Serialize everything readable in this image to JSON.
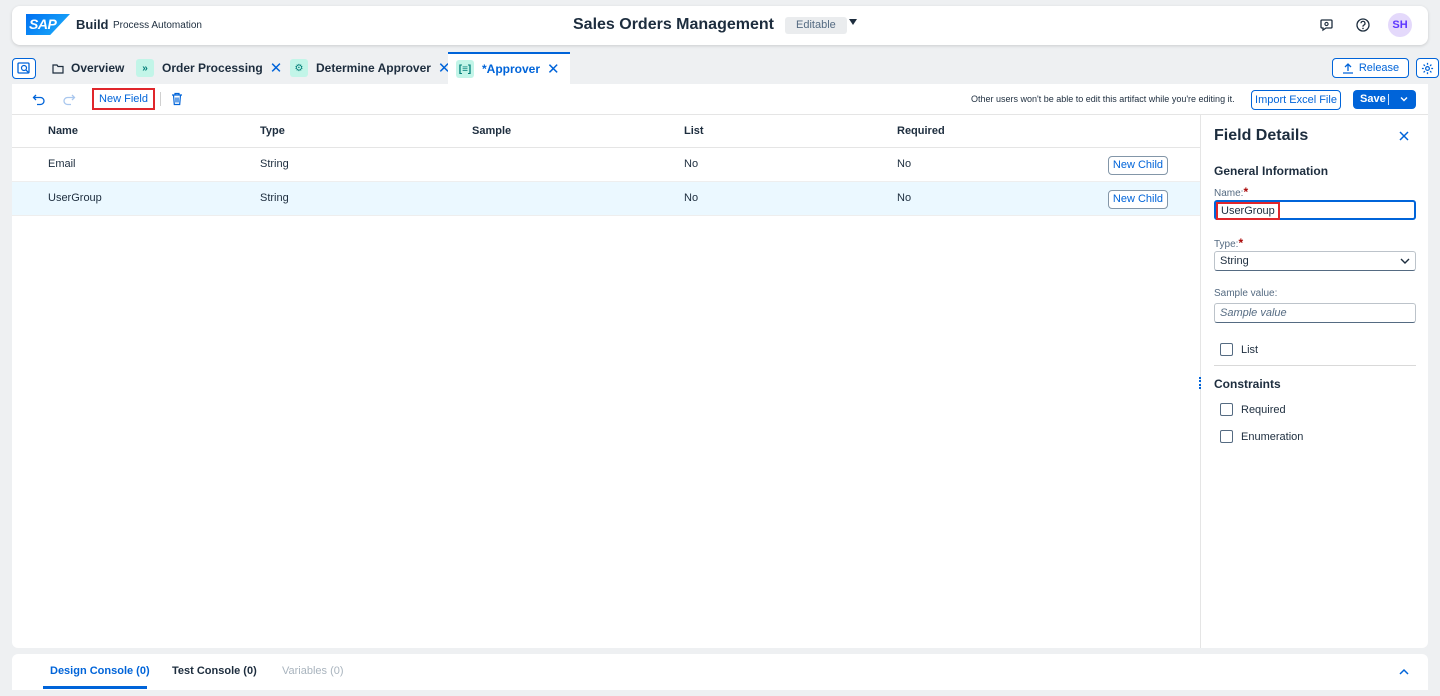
{
  "shell": {
    "logo_text": "SAP",
    "brand": "Build",
    "brand_sub": "Process Automation",
    "title": "Sales Orders Management",
    "status": "Editable",
    "avatar": "SH"
  },
  "tabs": [
    {
      "label": "Overview",
      "closable": false
    },
    {
      "label": "Order Processing",
      "closable": true
    },
    {
      "label": "Determine Approver",
      "closable": true
    },
    {
      "label": "*Approver",
      "closable": true,
      "active": true
    }
  ],
  "tab_actions": {
    "release": "Release"
  },
  "toolbar": {
    "new_field": "New Field",
    "note": "Other users won't be able to edit this artifact while you're editing it.",
    "import": "Import Excel File",
    "save": "Save"
  },
  "table": {
    "columns": [
      "Name",
      "Type",
      "Sample",
      "List",
      "Required"
    ],
    "rows": [
      {
        "name": "Email",
        "type": "String",
        "sample": "",
        "list": "No",
        "required": "No",
        "action": "New Child"
      },
      {
        "name": "UserGroup",
        "type": "String",
        "sample": "",
        "list": "No",
        "required": "No",
        "action": "New Child",
        "selected": true
      }
    ]
  },
  "details": {
    "title": "Field Details",
    "general": "General Information",
    "name_label": "Name:",
    "name_value": "UserGroup",
    "type_label": "Type:",
    "type_value": "String",
    "sample_label": "Sample value:",
    "sample_placeholder": "Sample value",
    "list_label": "List",
    "constraints": "Constraints",
    "required_label": "Required",
    "enumeration_label": "Enumeration",
    "required_marker": "*"
  },
  "console": {
    "tabs": [
      "Design Console (0)",
      "Test Console (0)",
      "Variables (0)"
    ]
  },
  "colors": {
    "accent": "#0064d9",
    "highlight": "#e0262b",
    "selected_row": "#ebf8ff"
  }
}
